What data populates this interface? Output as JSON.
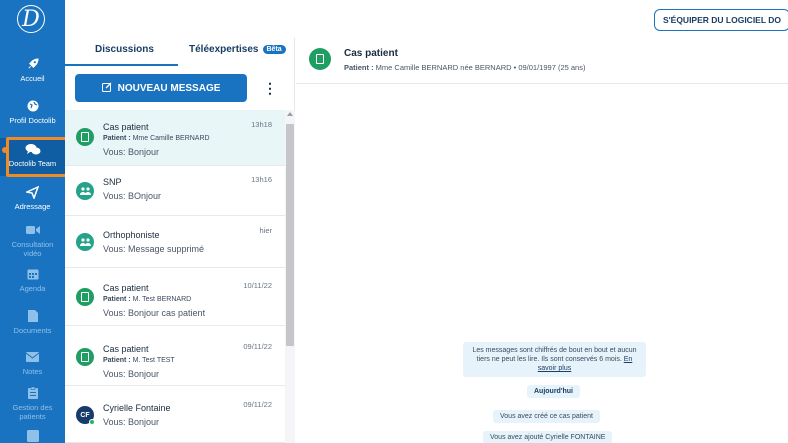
{
  "nav": {
    "logo": "D",
    "items": [
      {
        "label": "Accueil",
        "icon": "rocket-icon"
      },
      {
        "label": "Profil Doctolib",
        "icon": "globe-icon"
      },
      {
        "label": "Doctolib Team",
        "icon": "chat-bubbles-icon"
      },
      {
        "label": "Adressage",
        "icon": "send-icon"
      },
      {
        "label": "Consultation vidéo",
        "icon": "video-icon"
      },
      {
        "label": "Agenda",
        "icon": "calendar-icon"
      },
      {
        "label": "Documents",
        "icon": "file-icon"
      },
      {
        "label": "Notes",
        "icon": "mail-icon"
      },
      {
        "label": "Gestion des patients",
        "icon": "clipboard-icon"
      }
    ]
  },
  "topbar": {
    "equip_label": "S'ÉQUIPER DU LOGICIEL DO"
  },
  "tabs": {
    "discussions": "Discussions",
    "teleexpertises": "Téléexpertises",
    "beta": "Bêta"
  },
  "new_message": {
    "label": "NOUVEAU MESSAGE",
    "icon": "edit-icon"
  },
  "conversations": [
    {
      "title": "Cas patient",
      "sub_prefix": "Patient :",
      "sub": " Mme Camille BERNARD",
      "message": "Vous: Bonjour",
      "time": "13h18",
      "avatar": "document-icon"
    },
    {
      "title": "SNP",
      "message": "Vous: BOnjour",
      "time": "13h16",
      "avatar": "group-icon"
    },
    {
      "title": "Orthophoniste",
      "message": "Vous: Message supprimé",
      "time": "hier",
      "avatar": "group-icon"
    },
    {
      "title": "Cas patient",
      "sub_prefix": "Patient :",
      "sub": " M. Test BERNARD",
      "message": "Vous: Bonjour cas patient",
      "time": "10/11/22",
      "avatar": "document-icon"
    },
    {
      "title": "Cas patient",
      "sub_prefix": "Patient :",
      "sub": " M. Test TEST",
      "message": "Vous: Bonjour",
      "time": "09/11/22",
      "avatar": "document-icon"
    },
    {
      "title": "Cyrielle Fontaine",
      "initials": "CF",
      "message": "Vous: Bonjour",
      "time": "09/11/22"
    }
  ],
  "chat": {
    "title": "Cas patient",
    "sub_prefix": "Patient :",
    "sub": " Mme Camille BERNARD née BERNARD • 09/01/1997 (25 ans)",
    "encryption_text": "Les messages sont chiffrés de bout en bout et aucun tiers ne peut les lire. Ils sont conservés 6 mois.",
    "learn_more": "En savoir plus",
    "day": "Aujourd'hui",
    "events": [
      "Vous avez créé ce cas patient",
      "Vous avez ajouté Cyrielle FONTAINE"
    ]
  },
  "colors": {
    "nav": "#1a73c0",
    "accent": "#1a73c0",
    "highlight": "#f08a24",
    "selected_row": "#e8f6f8"
  }
}
